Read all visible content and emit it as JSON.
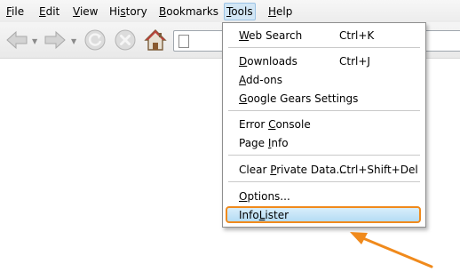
{
  "menubar": {
    "items": [
      {
        "pre": "",
        "mn": "F",
        "post": "ile"
      },
      {
        "pre": "",
        "mn": "E",
        "post": "dit"
      },
      {
        "pre": "",
        "mn": "V",
        "post": "iew"
      },
      {
        "pre": "Hi",
        "mn": "s",
        "post": "tory"
      },
      {
        "pre": "",
        "mn": "B",
        "post": "ookmarks"
      },
      {
        "pre": "",
        "mn": "T",
        "post": "ools"
      },
      {
        "pre": "",
        "mn": "H",
        "post": "elp"
      }
    ],
    "active_index": 5
  },
  "toolbar": {
    "back_icon": "back-arrow-icon",
    "forward_icon": "forward-arrow-icon",
    "reload_icon": "reload-icon",
    "stop_icon": "stop-icon",
    "home_icon": "home-icon",
    "page_icon": "page-icon"
  },
  "tools_menu": {
    "items": [
      {
        "pre": "",
        "mn": "W",
        "post": "eb Search",
        "shortcut": "Ctrl+K"
      },
      {
        "pre": "",
        "mn": "D",
        "post": "ownloads",
        "shortcut": "Ctrl+J"
      },
      {
        "pre": "",
        "mn": "A",
        "post": "dd-ons",
        "shortcut": ""
      },
      {
        "pre": "",
        "mn": "G",
        "post": "oogle Gears Settings",
        "shortcut": ""
      },
      {
        "pre": "Error ",
        "mn": "C",
        "post": "onsole",
        "shortcut": ""
      },
      {
        "pre": "Page ",
        "mn": "I",
        "post": "nfo",
        "shortcut": ""
      },
      {
        "pre": "Clear ",
        "mn": "P",
        "post": "rivate Data...",
        "shortcut": "Ctrl+Shift+Del"
      },
      {
        "pre": "",
        "mn": "O",
        "post": "ptions...",
        "shortcut": ""
      },
      {
        "pre": "Info",
        "mn": "L",
        "post": "ister",
        "shortcut": ""
      }
    ]
  },
  "colors": {
    "highlight_border": "#f08a1c",
    "highlight_fill": "#b5dcf4",
    "arrow": "#f08a1c"
  }
}
